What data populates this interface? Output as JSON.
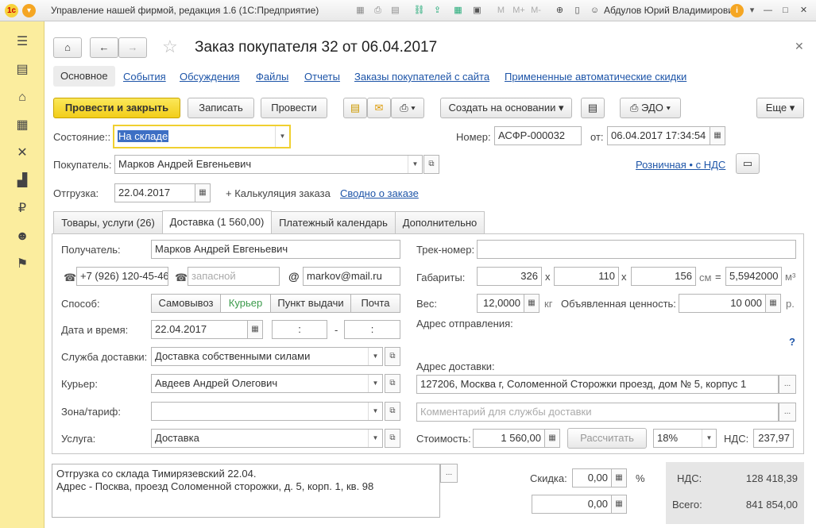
{
  "titlebar": {
    "title": "Управление нашей фирмой, редакция 1.6  (1С:Предприятие)",
    "m_label": "M",
    "mplus_label": "M+",
    "mminus_label": "M-",
    "user": "Абдулов Юрий Владимирович"
  },
  "sidebar": {
    "items": [
      "menu-icon",
      "desk-icon",
      "basket-icon",
      "factory-icon",
      "tools-icon",
      "chart-icon",
      "ruble-icon",
      "people-icon",
      "flag-icon"
    ]
  },
  "header": {
    "title": "Заказ покупателя 32 от 06.04.2017",
    "nav_links": [
      "Основное",
      "События",
      "Обсуждения",
      "Файлы",
      "Отчеты",
      "Заказы покупателей с сайта",
      "Примененные автоматические скидки"
    ]
  },
  "toolbar": {
    "post_close": "Провести и закрыть",
    "save": "Записать",
    "post": "Провести",
    "create_based": "Создать на основании",
    "edo": "ЭДО",
    "more": "Еще"
  },
  "form": {
    "state_label": "Состояние::",
    "state_value": "На складе",
    "number_label": "Номер:",
    "number_value": "АСФР-000032",
    "from_label": "от:",
    "date_value": "06.04.2017 17:34:54",
    "buyer_label": "Покупатель:",
    "buyer_value": "Марков Андрей Евгеньевич",
    "retail_link": "Розничная • с НДС",
    "shipment_label": "Отгрузка:",
    "shipment_value": "22.04.2017",
    "calc_label": "+ Калькуляция заказа",
    "summary_link": "Сводно о заказе"
  },
  "tabs": [
    "Товары, услуги (26)",
    "Доставка (1 560,00)",
    "Платежный календарь",
    "Дополнительно"
  ],
  "delivery": {
    "recipient_label": "Получатель:",
    "recipient_value": "Марков Андрей Евгеньевич",
    "phone_value": "+7 (926) 120-45-46",
    "phone2_placeholder": "запасной",
    "email_value": "markov@mail.ru",
    "method_label": "Способ:",
    "methods": [
      "Самовывоз",
      "Курьер",
      "Пункт выдачи",
      "Почта"
    ],
    "datetime_label": "Дата и время:",
    "date_value": "22.04.2017",
    "time_from": ":",
    "time_to": ":",
    "dash": "-",
    "service_label": "Служба доставки:",
    "service_value": "Доставка собственными силами",
    "courier_label": "Курьер:",
    "courier_value": "Авдеев Андрей Олегович",
    "zone_label": "Зона/тариф:",
    "zone_value": "",
    "svc_label": "Услуга:",
    "svc_value": "Доставка",
    "track_label": "Трек-номер:",
    "track_value": "",
    "dims_label": "Габариты:",
    "dim1": "326",
    "dim2": "110",
    "dim3": "156",
    "x": "x",
    "cm": "см",
    "eq": "=",
    "volume": "5,5942000",
    "m3": "м³",
    "weight_label": "Вес:",
    "weight_value": "12,0000",
    "kg": "кг",
    "declared_label": "Объявленная ценность:",
    "declared_value": "10 000",
    "rub": "р.",
    "from_address_label": "Адрес отправления:",
    "question": "?",
    "to_address_label": "Адрес доставки:",
    "to_address_value": "127206, Москва г, Соломенной Сторожки проезд, дом № 5, корпус 1",
    "comment_placeholder": "Комментарий для службы доставки",
    "cost_label": "Стоимость:",
    "cost_value": "1 560,00",
    "calc_button": "Рассчитать",
    "vat_rate": "18%",
    "vat_label": "НДС:",
    "vat_value": "237,97"
  },
  "footer": {
    "note_line1": "Отгрузка со склада Тимирязевский 22.04.",
    "note_line2": "Адрес - Посква, проезд Соломенной сторожки, д. 5, корп. 1, кв. 98",
    "discount_label": "Скидка:",
    "discount_value": "0,00",
    "percent": "%",
    "amount_value": "0,00",
    "vat_total_label": "НДС:",
    "vat_total_value": "128 418,39",
    "total_label": "Всего:",
    "total_value": "841 854,00"
  }
}
